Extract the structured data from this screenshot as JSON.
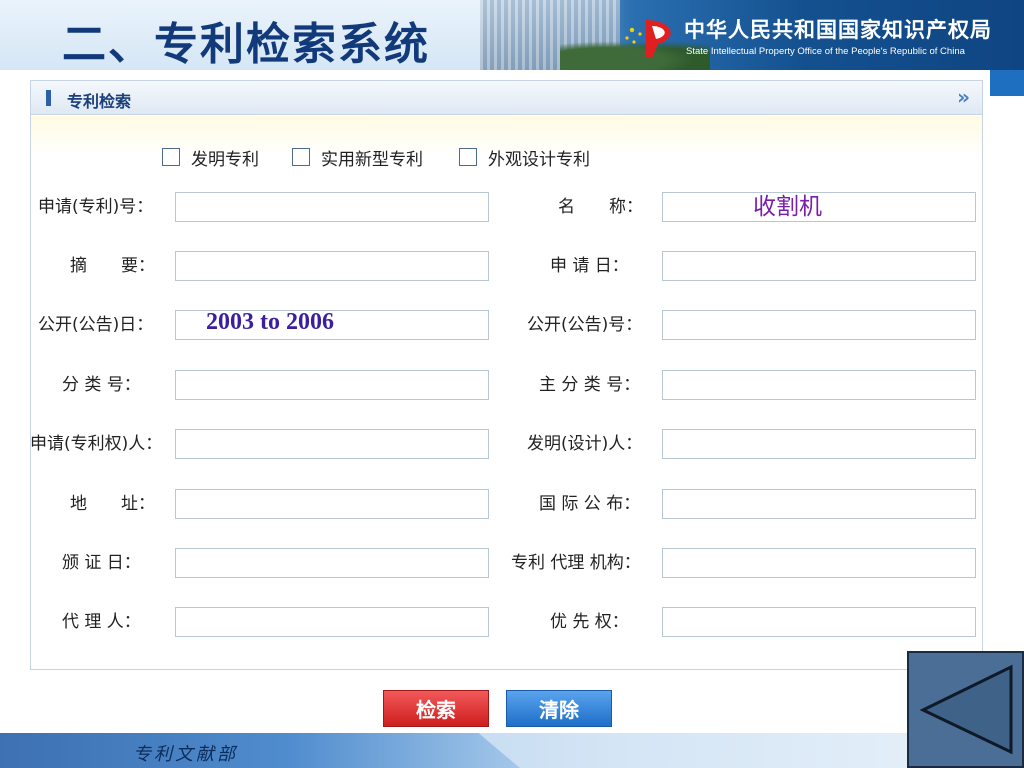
{
  "header": {
    "title": "二、专利检索系统",
    "org_cn": "中华人民共和国国家知识产权局",
    "org_en": "State Intellectual Property Office of the People's Republic of China"
  },
  "panel": {
    "title": "专利检索",
    "arrow": "»"
  },
  "patent_types": [
    {
      "label": "发明专利",
      "checked": false
    },
    {
      "label": "实用新型专利",
      "checked": false
    },
    {
      "label": "外观设计专利",
      "checked": false
    }
  ],
  "fields": {
    "app_no": {
      "label": "申请(专利)号：",
      "value": ""
    },
    "name": {
      "label": "名　　称：",
      "value": ""
    },
    "abstract": {
      "label": "摘　　要：",
      "value": ""
    },
    "app_date": {
      "label": "申 请 日：",
      "value": ""
    },
    "pub_date": {
      "label": "公开(公告)日：",
      "value": ""
    },
    "pub_no": {
      "label": "公开(公告)号：",
      "value": ""
    },
    "class_no": {
      "label": "分 类 号：",
      "value": ""
    },
    "main_class_no": {
      "label": "主 分 类 号：",
      "value": ""
    },
    "applicant": {
      "label": "申请(专利权)人：",
      "value": ""
    },
    "inventor": {
      "label": "发明(设计)人：",
      "value": ""
    },
    "address": {
      "label": "地　　址：",
      "value": ""
    },
    "intl_pub": {
      "label": "国 际 公 布：",
      "value": ""
    },
    "grant_date": {
      "label": "颁 证 日：",
      "value": ""
    },
    "agency": {
      "label": "专利 代理 机构：",
      "value": ""
    },
    "agent": {
      "label": "代 理 人：",
      "value": ""
    },
    "priority": {
      "label": "优 先 权：",
      "value": ""
    }
  },
  "annotations": {
    "pub_date_text": "2003 to 2006",
    "name_text": "收割机"
  },
  "buttons": {
    "search": "检索",
    "clear": "清除"
  },
  "footer": {
    "text": "专利文献部"
  },
  "colors": {
    "title": "#123a7a",
    "search_button": "#cf1e1e",
    "clear_button": "#1e6fc8",
    "panel_border": "#c6d4e3"
  }
}
